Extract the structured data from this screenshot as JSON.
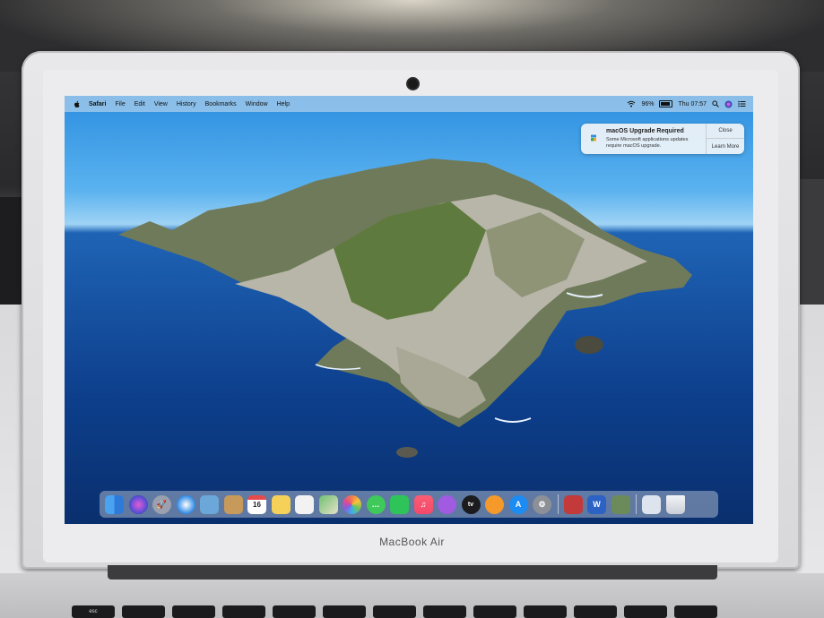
{
  "device": {
    "model_label": "MacBook Air"
  },
  "menubar": {
    "app_name": "Safari",
    "items": [
      "File",
      "Edit",
      "View",
      "History",
      "Bookmarks",
      "Window",
      "Help"
    ],
    "battery_percent": "96%",
    "clock": "Thu 07:57"
  },
  "notification": {
    "title": "macOS Upgrade Required",
    "body": "Some Microsoft applications updates require macOS upgrade.",
    "close_label": "Close",
    "learn_more_label": "Learn More"
  },
  "calendar_icon": {
    "day": "16"
  },
  "dock": {
    "apps": [
      {
        "name": "finder",
        "color": "#3b8fe8"
      },
      {
        "name": "siri",
        "color": "#6a4bd6"
      },
      {
        "name": "launchpad",
        "color": "#8a8fa0"
      },
      {
        "name": "safari",
        "color": "#2a88e6"
      },
      {
        "name": "preview",
        "color": "#6ba7d9"
      },
      {
        "name": "contacts",
        "color": "#c79a5b"
      },
      {
        "name": "calendar",
        "color": "#ffffff"
      },
      {
        "name": "notes",
        "color": "#f6d15a"
      },
      {
        "name": "reminders",
        "color": "#f2f2f2"
      },
      {
        "name": "maps",
        "color": "#6fbf72"
      },
      {
        "name": "photos",
        "color": "#f07d4a"
      },
      {
        "name": "messages",
        "color": "#3ec95a"
      },
      {
        "name": "facetime",
        "color": "#2fc45a"
      },
      {
        "name": "music",
        "color": "#f2496a"
      },
      {
        "name": "podcasts",
        "color": "#a05be0"
      },
      {
        "name": "apple-tv",
        "color": "#1c1c1e"
      },
      {
        "name": "books",
        "color": "#f59a2a"
      },
      {
        "name": "app-store",
        "color": "#1c8bf2"
      },
      {
        "name": "system-preferences",
        "color": "#8d9096"
      }
    ],
    "extra_apps": [
      {
        "name": "photo-booth",
        "color": "#c23a3a"
      },
      {
        "name": "word",
        "color": "#2b62c4"
      },
      {
        "name": "migration-assistant",
        "color": "#6b8b5a"
      }
    ],
    "trailing": [
      {
        "name": "downloads",
        "color": "#dde4ee"
      },
      {
        "name": "trash",
        "color": "#e6e9ee"
      }
    ]
  },
  "keyboard": {
    "keys": [
      "esc",
      "",
      "",
      "",
      "",
      "",
      "",
      "",
      "",
      "",
      "",
      "",
      ""
    ]
  }
}
